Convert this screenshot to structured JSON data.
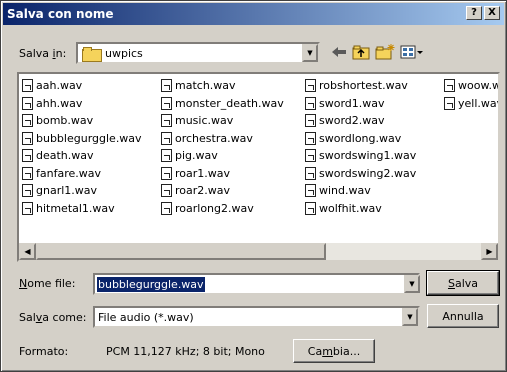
{
  "window": {
    "title": "Salva con nome",
    "help_label": "?",
    "close_label": "X"
  },
  "save_in": {
    "label_prefix": "Salva ",
    "label_key": "i",
    "label_suffix": "n:",
    "value": "uwpics"
  },
  "toolbar": {
    "back_icon": "back-arrow-icon",
    "up_icon": "up-folder-icon",
    "new_folder_icon": "new-folder-icon",
    "view_icon": "view-menu-icon"
  },
  "files": {
    "col1": [
      "aah.wav",
      "ahh.wav",
      "bomb.wav",
      "bubblegurggle.wav",
      "death.wav",
      "fanfare.wav",
      "gnarl1.wav",
      "hitmetal1.wav"
    ],
    "col2": [
      "match.wav",
      "monster_death.wav",
      "music.wav",
      "orchestra.wav",
      "pig.wav",
      "roar1.wav",
      "roar2.wav",
      "roarlong2.wav"
    ],
    "col3": [
      "robshortest.wav",
      "sword1.wav",
      "sword2.wav",
      "swordlong.wav",
      "swordswing1.wav",
      "swordswing2.wav",
      "wind.wav",
      "wolfhit.wav"
    ],
    "col4": [
      "woow.wav",
      "yell.wav"
    ]
  },
  "filename": {
    "label_key": "N",
    "label_rest": "ome file:",
    "value": "bubblegurggle.wav"
  },
  "filetype": {
    "label_a": "Sal",
    "label_key": "v",
    "label_b": "a come:",
    "value": "File audio (*.wav)"
  },
  "format": {
    "label": "Formato:",
    "value": "PCM 11,127 kHz; 8 bit; Mono"
  },
  "buttons": {
    "save_key": "S",
    "save_rest": "alva",
    "cancel": "Annulla",
    "change_a": "Ca",
    "change_key": "m",
    "change_b": "bia..."
  }
}
